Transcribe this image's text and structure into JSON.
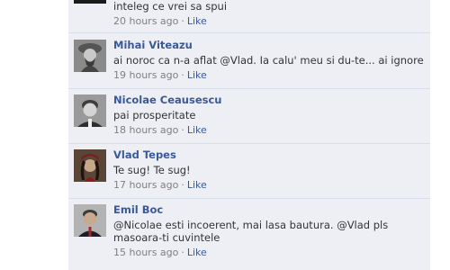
{
  "comments": [
    {
      "author": "",
      "text": "inteleg ce vrei sa spui",
      "time": "20 hours ago",
      "like": "Like"
    },
    {
      "author": "Mihai Viteazu",
      "text": "ai noroc ca n-a aflat @Vlad. Ia calu' meu si du-te... ai ignore",
      "time": "19 hours ago",
      "like": "Like"
    },
    {
      "author": "Nicolae Ceausescu",
      "text": "pai prosperitate",
      "time": "18 hours ago",
      "like": "Like"
    },
    {
      "author": "Vlad Tepes",
      "text": "Te sug! Te sug!",
      "time": "17 hours ago",
      "like": "Like"
    },
    {
      "author": "Emil Boc",
      "text": "@Nicolae esti incoerent, mai lasa bautura. @Vlad pls masoara-ti cuvintele",
      "time": "15 hours ago",
      "like": "Like"
    }
  ],
  "separator": "·"
}
